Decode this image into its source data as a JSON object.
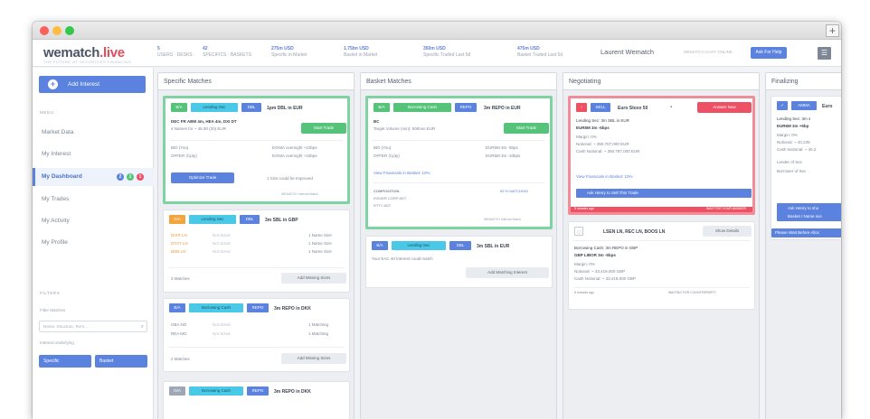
{
  "window": {
    "new_tab": "+"
  },
  "brand": {
    "name": "wematch",
    "suffix": ".live",
    "tagline": "THE FUTURE OF SECURITIES FINANCING"
  },
  "header": {
    "stats": [
      {
        "value": "5",
        "label": "USERS · DESKS"
      },
      {
        "value": "42",
        "label": "SPECIFICS · BASKETS"
      },
      {
        "value": "275m USD",
        "label": "Specific in Market"
      },
      {
        "value": "1.75bn USD",
        "label": "Basket in Market"
      },
      {
        "value": "350m USD",
        "label": "Specific Traded Last 5d"
      },
      {
        "value": "475m USD",
        "label": "Basket Traded Last 5d"
      }
    ],
    "user": "Laurent Wematch",
    "chat_status": "WEMATCH CHAT ONLINE",
    "help_label": "Ask For Help",
    "menu_icon": "☰"
  },
  "sidebar": {
    "add_interest": "Add Interest",
    "menu_title": "MENU",
    "items": [
      {
        "label": "Market Data"
      },
      {
        "label": "My Interest"
      },
      {
        "label": "My Dashboard"
      },
      {
        "label": "My Trades"
      },
      {
        "label": "My Activity"
      },
      {
        "label": "My Profile"
      }
    ],
    "dashboard_badges": [
      "2",
      "1",
      "1"
    ],
    "filters_title": "FILTERS",
    "filter_matches_label": "Filter Matches",
    "filter_placeholder": "Name, Structure, Term...",
    "interest_underlying_label": "Interest Underlying",
    "filter_specific": "Specific",
    "filter_basket": "Basket"
  },
  "columns": {
    "specific": {
      "title": "Specific Matches",
      "card1": {
        "tag1": "B/A",
        "tag2": "Lending Sec",
        "tag3": "DBL",
        "title": "1pm DBL in EUR",
        "line1": "DEC FR ABM 4m, HEA 4m, DXI DT",
        "line2": "4 Names for ~ 45.00 (20) EUR",
        "action": "Start Trade",
        "bid_label": "BID (You)",
        "bid_value": "EONIA overnight +10bps",
        "offer_label": "OFFER (Cpty)",
        "offer_value": "EONIA overnight +15bps",
        "optimize": "Optimize Trade",
        "note": "1 Size could be Improved",
        "footer": "WEMATCH Internal Match"
      },
      "card2": {
        "tag1": "O/A",
        "tag2": "Lending Sec",
        "tag3": "DBL",
        "title": "3m SBL in GBP",
        "rows": [
          {
            "name": "DIXR LN",
            "status": "Not Sized",
            "info": "1 Name Size"
          },
          {
            "name": "DTXT LN",
            "status": "Not Sized",
            "info": "1 Name Size"
          },
          {
            "name": "BDB LN",
            "status": "Not Sized",
            "info": "1 Name Size"
          }
        ],
        "left_note": "3 Matches",
        "action": "Add Missing Sizes"
      },
      "card3": {
        "tag1": "B/A",
        "tag2": "Borrowing Cash",
        "tag3": "REPO",
        "title": "3m REPO in DKK",
        "rows": [
          {
            "name": "GBA NO",
            "status": "Not Sized",
            "info": "1 Matching"
          },
          {
            "name": "REA MO",
            "status": "Not Sized",
            "info": "1 Matching"
          }
        ],
        "left_note": "2 Matches",
        "action": "Add Missing Sizes"
      },
      "card4": {
        "tag1": "O/A",
        "tag2": "Borrowing Cash",
        "tag3": "REPO",
        "title": "3m REPO in DKK"
      }
    },
    "basket": {
      "title": "Basket Matches",
      "card1": {
        "tag1": "B/A",
        "tag2": "Borrowing Cash",
        "tag3": "REPO",
        "title": "3m REPO in EUR",
        "line1": "BC",
        "line2": "Target Volume (min): 500mio EUR",
        "action": "Start Trade",
        "bid_label": "BID (You)",
        "bid_value": "EUR6M 3m -5bps",
        "offer_label": "OFFER (Cpty)",
        "offer_value": "EUR6M 3m -10bps",
        "link": "View Financials in Basket: 10%",
        "comp_label": "COMPOSITION",
        "comp_value": "89 % MATCHING",
        "detail1": "ISSUER  CORP ADT",
        "detail2": "RTTY    ADT",
        "footer": "WEMATCH Internal Match"
      },
      "card2": {
        "tag1": "B/A",
        "tag2": "Lending Sec",
        "tag3": "DBL",
        "title": "3m SBL in EUR",
        "line1": "Your EAC 40 Interest could match",
        "action": "Add Matching Interest"
      }
    },
    "negotiating": {
      "title": "Negotiating",
      "card1": {
        "tag1": "↑",
        "tag2": "SELL",
        "title": "Euro Stoxx 50",
        "action": "Answer Now",
        "line1": "Lending Sec: 3m SBL in EUR",
        "line2": "EUR6M 3m -5bps",
        "line3": "Margin: 0%",
        "line4": "Notional: ~ 350,787,000 EUR",
        "line5": "Cash Notional: ~ 350,787,000 EUR",
        "link": "View Financials in Basket: 10%",
        "bar": "Ask Henry to Sell This Trade",
        "footer_left": "5 minutes ago",
        "footer_right": "WAIT FOR YOUR ANSWER"
      },
      "card2": {
        "icon": "▢",
        "title": "LSEN LN, REC LN, BOOS LN",
        "action": "Show Details",
        "line1": "Borrowing Cash: 3m REPO in GBP",
        "line2": "GBP LIBOR 3m -5bps",
        "line3": "Margin: 0%",
        "line4": "Notional: ~ 33,419,000 GBP",
        "line5": "Cash Notional: ~ 33,419,000 GBP",
        "footer_left": "5 minutes ago",
        "footer_right": "WAITING FOR COUNTERPARTY"
      }
    },
    "finalizing": {
      "title": "Finalizing",
      "card1": {
        "tag1": "✓",
        "tag2": "AMMA",
        "title": "Euro",
        "line1": "Lending Sec: 3m s",
        "line2": "EUR6M 3m +5bp",
        "line3": "Margin: 0%",
        "line4": "Notional: ~ 40,239",
        "line5": "Cash Notional: ~ 40,2",
        "line6": "Lender of Sec",
        "line7": "Borrower of Sec",
        "bar": "Ask Henry to sho",
        "bar2": "Basket / Name sce",
        "footer": "Please Wait Before Alloc"
      }
    }
  }
}
